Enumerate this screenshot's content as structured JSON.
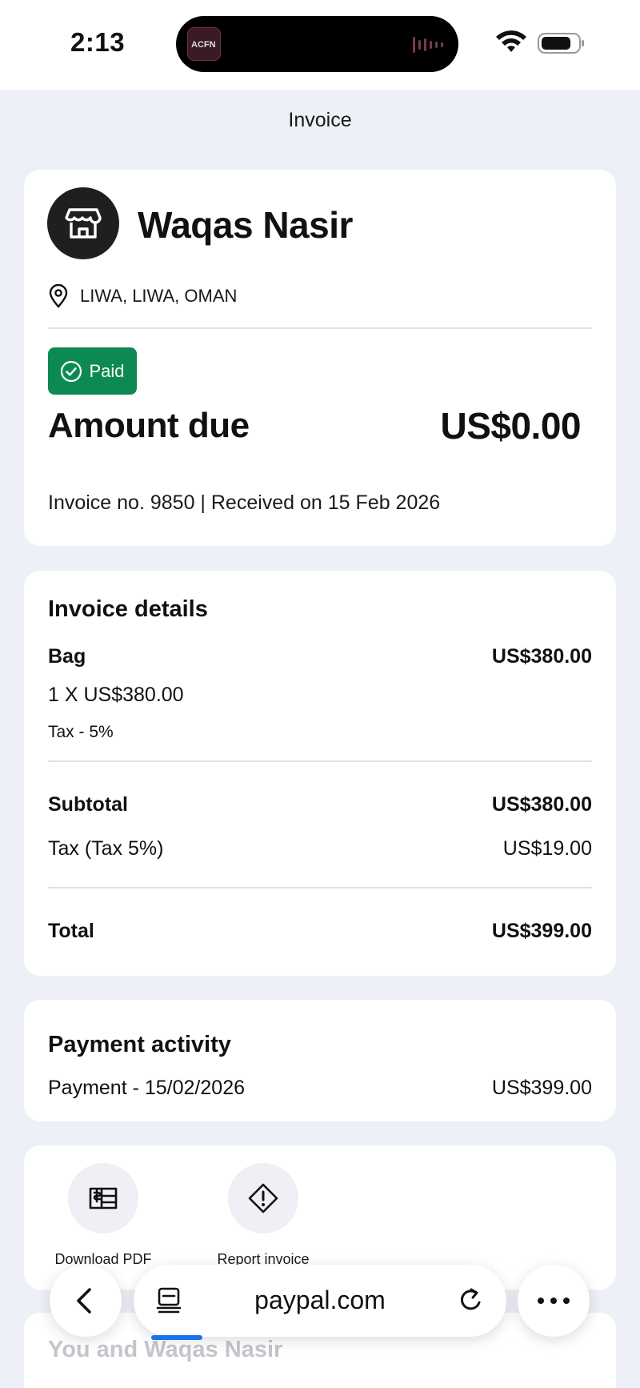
{
  "status_bar": {
    "time": "2:13",
    "island_thumb_text": "ACFN"
  },
  "page": {
    "title": "Invoice"
  },
  "merchant": {
    "name": "Waqas Nasir",
    "location": "LIWA, LIWA, OMAN",
    "status": "Paid",
    "amount_due_label": "Amount due",
    "amount_due_value": "US$0.00",
    "invoice_meta": "Invoice no. 9850 | Received on 15 Feb 2026",
    "status_color": "#0d8a52"
  },
  "details": {
    "title": "Invoice details",
    "item_name": "Bag",
    "item_amount": "US$380.00",
    "item_qty_price": "1 X US$380.00",
    "item_tax": "Tax - 5%",
    "subtotal_label": "Subtotal",
    "subtotal_value": "US$380.00",
    "tax_label": "Tax (Tax 5%)",
    "tax_value": "US$19.00",
    "total_label": "Total",
    "total_value": "US$399.00"
  },
  "payment_activity": {
    "title": "Payment activity",
    "entry_label": "Payment - 15/02/2026",
    "entry_value": "US$399.00"
  },
  "actions": {
    "download_label": "Download PDF",
    "report_label": "Report invoice"
  },
  "next_section": {
    "title": "You and Waqas Nasir"
  },
  "browser": {
    "url": "paypal.com",
    "accent_color": "#1a73e8"
  }
}
